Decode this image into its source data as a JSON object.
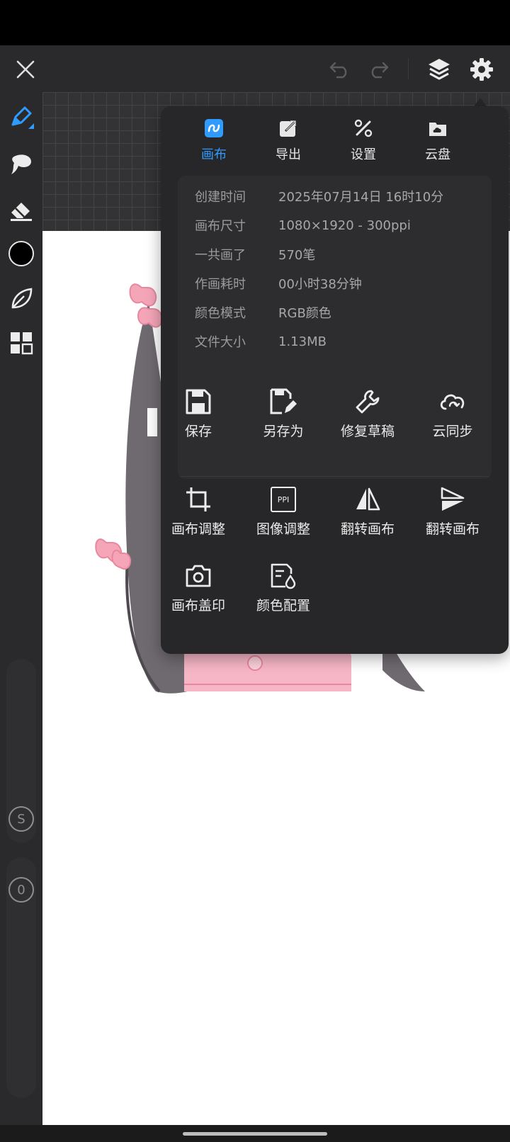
{
  "toolbar": {
    "close": "close-icon",
    "undo": "undo-icon",
    "redo": "redo-icon",
    "layers": "layers-icon",
    "settings": "gear-icon"
  },
  "sidebar": {
    "tools": [
      "pen-icon",
      "brush-icon",
      "eraser-icon",
      "color-swatch",
      "leaf-icon",
      "grid-icon"
    ],
    "accent": "#2f9bff",
    "swatch_color": "#000000",
    "size_badge": "S",
    "opacity_badge": "0"
  },
  "menu": {
    "tabs": [
      {
        "label": "画布",
        "icon": "canvas-icon",
        "active": true
      },
      {
        "label": "导出",
        "icon": "export-icon",
        "active": false
      },
      {
        "label": "设置",
        "icon": "tools-icon",
        "active": false
      },
      {
        "label": "云盘",
        "icon": "cloud-folder-icon",
        "active": false
      }
    ],
    "info": [
      {
        "label": "创建时间",
        "value": "2025年07月14日 16时10分"
      },
      {
        "label": "画布尺寸",
        "value": "1080×1920 - 300ppi"
      },
      {
        "label": "一共画了",
        "value": "570笔"
      },
      {
        "label": "作画耗时",
        "value": "00小时38分钟"
      },
      {
        "label": "颜色模式",
        "value": "RGB颜色"
      },
      {
        "label": "文件大小",
        "value": "1.13MB"
      }
    ],
    "actions_row1": [
      {
        "label": "保存",
        "icon": "save-icon"
      },
      {
        "label": "另存为",
        "icon": "save-as-icon"
      },
      {
        "label": "修复草稿",
        "icon": "wrench-icon"
      },
      {
        "label": "云同步",
        "icon": "cloud-sync-icon"
      }
    ],
    "actions_row2": [
      {
        "label": "画布调整",
        "icon": "crop-icon"
      },
      {
        "label": "图像调整",
        "icon": "ppi-icon",
        "badge": "PPI"
      },
      {
        "label": "翻转画布",
        "icon": "flip-horizontal-icon"
      },
      {
        "label": "翻转画布",
        "icon": "flip-vertical-icon"
      }
    ],
    "actions_row3": [
      {
        "label": "画布盖印",
        "icon": "camera-icon"
      },
      {
        "label": "颜色配置",
        "icon": "color-config-icon"
      }
    ]
  }
}
